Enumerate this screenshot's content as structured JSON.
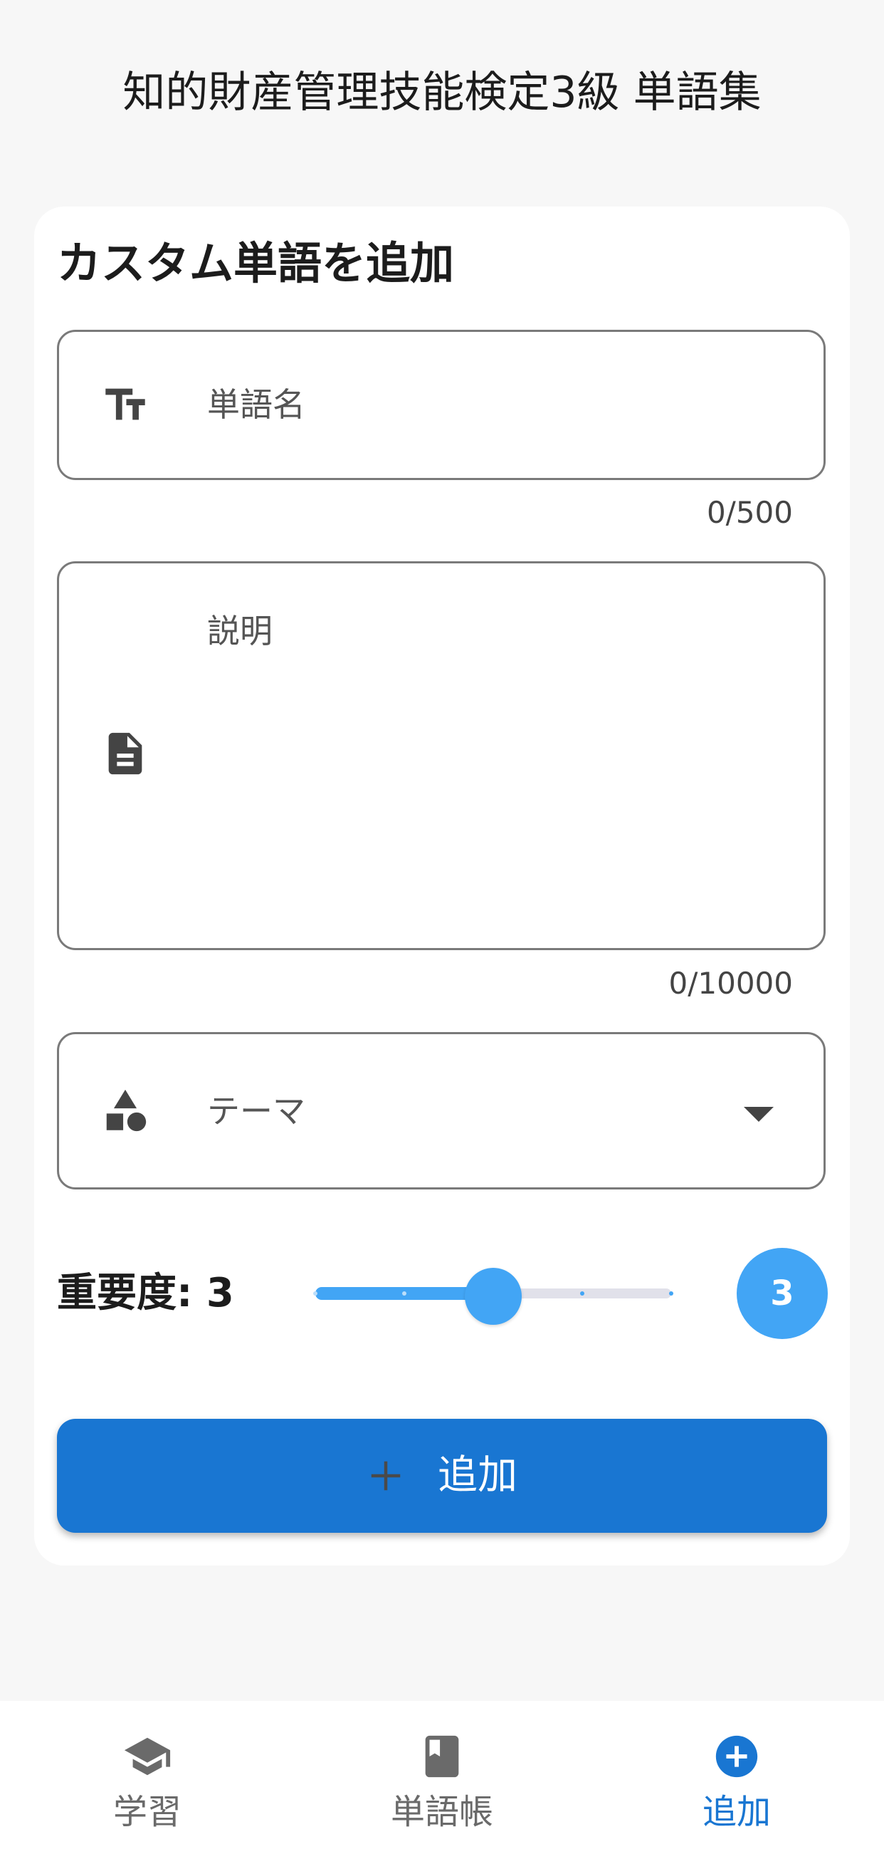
{
  "app": {
    "title": "知的財産管理技能検定3級 単語集"
  },
  "form": {
    "title": "カスタム単語を追加",
    "word_name": {
      "placeholder": "単語名",
      "counter": "0/500",
      "icon": "text-size-icon"
    },
    "description": {
      "placeholder": "説明",
      "counter": "0/10000",
      "icon": "document-icon"
    },
    "theme": {
      "placeholder": "テーマ",
      "icon": "shapes-icon"
    },
    "importance": {
      "label": "重要度: 3",
      "value": 3,
      "min": 1,
      "max": 5,
      "badge": "3"
    },
    "submit": {
      "label": "追加",
      "icon": "plus-icon"
    }
  },
  "bottom_nav": {
    "items": [
      {
        "label": "学習",
        "icon": "school-icon",
        "active": false
      },
      {
        "label": "単語帳",
        "icon": "book-icon",
        "active": false
      },
      {
        "label": "追加",
        "icon": "add-circle-icon",
        "active": true
      }
    ]
  },
  "colors": {
    "accent": "#1976d2",
    "slider": "#42a5f5",
    "slider_track": "#e1e1ea",
    "inactive_nav": "#6a6a6a"
  }
}
